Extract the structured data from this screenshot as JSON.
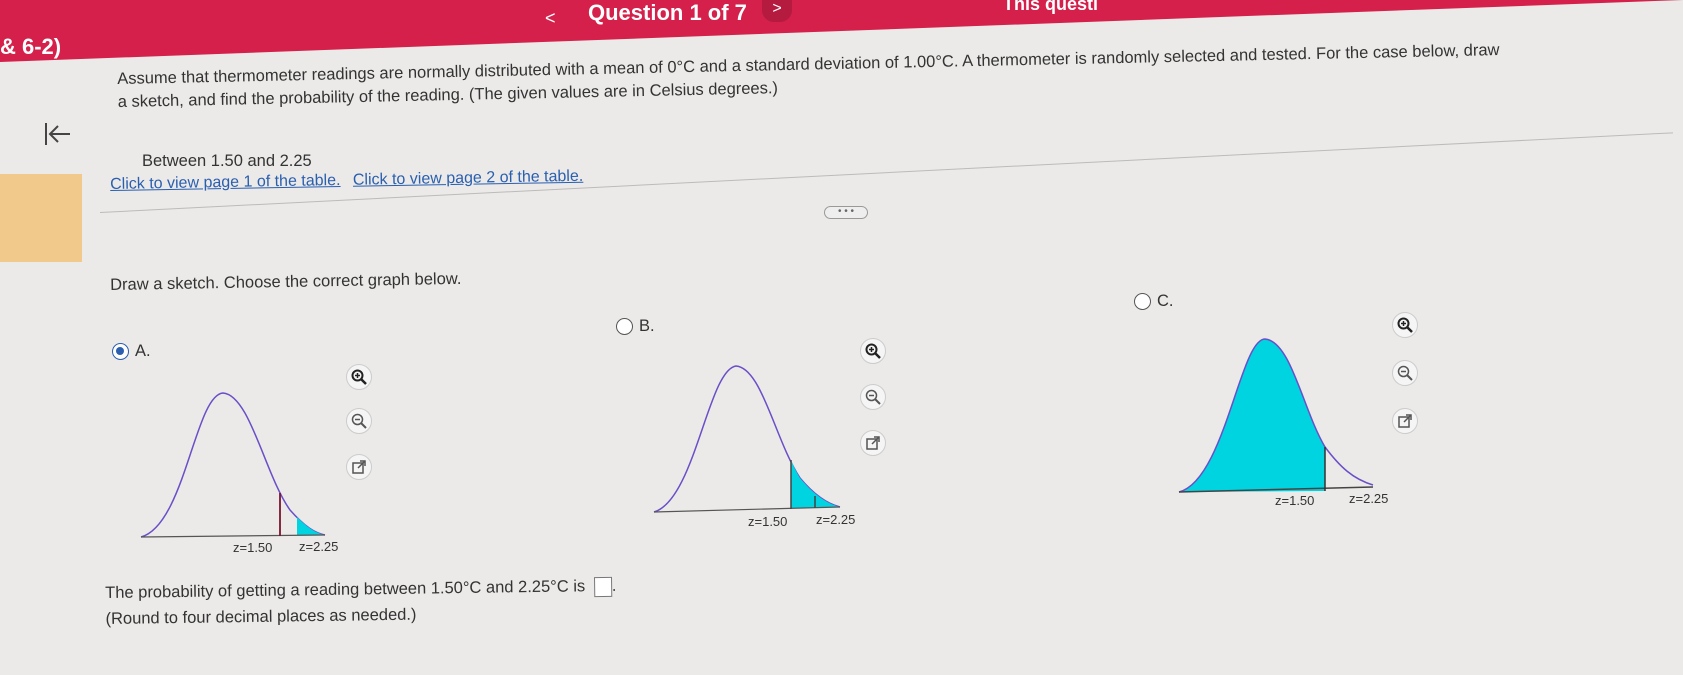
{
  "header": {
    "chapter": "& 6-2)",
    "prev": "<",
    "title": "Question 1 of 7",
    "next": ">",
    "this_question": "This questi"
  },
  "sidebar": {
    "collapse_icon": "collapse-left-icon"
  },
  "question": {
    "prompt_line1": "Assume that thermometer readings are normally distributed with a mean of 0°C and a standard deviation of 1.00°C. A thermometer is randomly selected and tested. For the case below, draw",
    "prompt_line2": "a sketch, and find the probability of the reading. (The given values are in Celsius degrees.)",
    "case": "Between 1.50 and 2.25",
    "link1": "Click to view page 1 of the table.",
    "link2": "Click to view page 2 of the table.",
    "more": "• • •",
    "draw_prompt": "Draw a sketch. Choose the correct graph below."
  },
  "options": [
    {
      "letter": "A.",
      "selected": true,
      "z1": "z=1.50",
      "z2": "z=2.25"
    },
    {
      "letter": "B.",
      "selected": false,
      "z1": "z=1.50",
      "z2": "z=2.25"
    },
    {
      "letter": "C.",
      "selected": false,
      "z1": "z=1.50",
      "z2": "z=2.25"
    }
  ],
  "answer": {
    "line1": "The probability of getting a reading between 1.50°C and 2.25°C is",
    "line2": "(Round to four decimal places as needed.)",
    "value": ""
  },
  "colors": {
    "header": "#d4204a",
    "shade": "#00d4e0",
    "curve": "#6a4fc8",
    "link": "#2a5fb0",
    "sidebar_accent": "#f1c98b"
  }
}
